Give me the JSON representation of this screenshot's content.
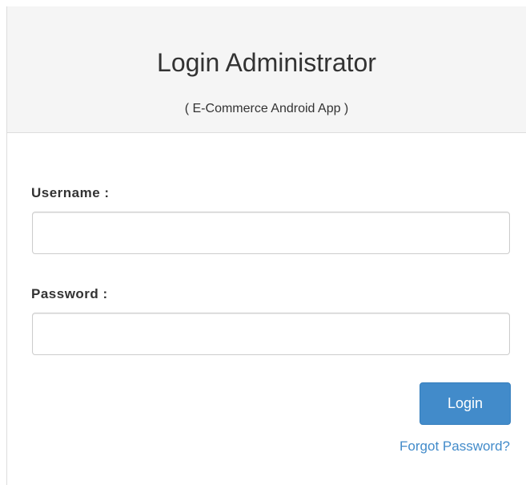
{
  "header": {
    "title": "Login Administrator",
    "subtitle": "( E-Commerce Android App )"
  },
  "form": {
    "username_label": "Username :",
    "username_value": "",
    "password_label": "Password :",
    "password_value": "",
    "login_label": "Login",
    "forgot_label": "Forgot Password?"
  },
  "colors": {
    "primary": "#428bca",
    "heading_bg": "#f5f5f5",
    "border": "#dddddd"
  }
}
